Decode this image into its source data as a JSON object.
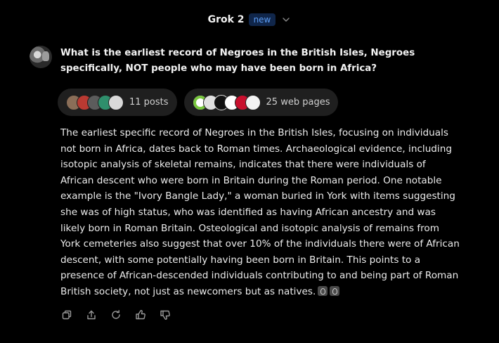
{
  "header": {
    "model_name": "Grok 2",
    "badge": "new",
    "badge_color": "#5b9df5"
  },
  "user_message": {
    "text": "What is the earliest record of Negroes in the British Isles, Negroes specifically, NOT people who may have been born in Africa?"
  },
  "sources": {
    "posts_label": "11 posts",
    "web_label": "25 web pages",
    "post_avatar_colors": [
      "#8a6e58",
      "#b93a32",
      "#5c5c5c",
      "#2f8f6c",
      "#d9d9d9"
    ],
    "web_icon_colors": [
      "#78c63e",
      "#e0e0e0",
      "#111111",
      "#ffffff",
      "#c8102e",
      "#f2f2f2"
    ]
  },
  "response": {
    "text": "The earliest specific record of Negroes in the British Isles, focusing on individuals not born in Africa, dates back to Roman times. Archaeological evidence, including isotopic analysis of skeletal remains, indicates that there were individuals of African descent who were born in Britain during the Roman period. One notable example is the \"Ivory Bangle Lady,\" a woman buried in York with items suggesting she was of high status, who was identified as having African ancestry and was likely born in Roman Britain. Osteological and isotopic analysis of remains from York cemeteries also suggest that over 10% of the individuals there were of African descent, with some potentially having been born in Britain. This points to a presence of African-descended individuals contributing to and being part of Roman British society, not just as newcomers but as natives."
  },
  "actions": {
    "icons": [
      "copy-icon",
      "share-icon",
      "regenerate-icon",
      "thumbs-up-icon",
      "thumbs-down-icon"
    ]
  }
}
